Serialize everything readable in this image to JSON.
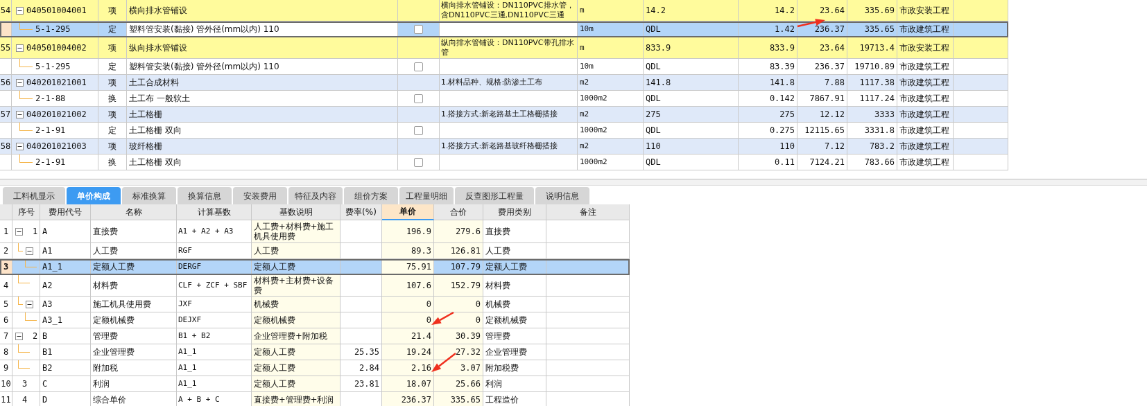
{
  "items": [
    {
      "line": "54",
      "code": "040501004001",
      "type": "项",
      "name": "横向排水管铺设",
      "desc": "横向排水管铺设：DN110PVC排水管，含DN110PVC三通,DN110PVC三通",
      "unit": "m",
      "qty_expr": "14.2",
      "qty": "14.2",
      "price": "23.64",
      "total": "335.69",
      "category": "市政安装工程",
      "color": "#fffb9c",
      "expanded": true,
      "selected": false,
      "children": [
        {
          "code": "5-1-295",
          "type": "定",
          "name": "塑料管安装(黏接) 管外径(mm以内) 110",
          "checked": false,
          "unit": "10m",
          "qty_expr": "QDL",
          "qty": "1.42",
          "price": "236.37",
          "total": "335.65",
          "category": "市政建筑工程",
          "selected": true
        }
      ]
    },
    {
      "line": "55",
      "code": "040501004002",
      "type": "项",
      "name": "纵向排水管铺设",
      "desc": "纵向排水管铺设：DN110PVC带孔排水管",
      "unit": "m",
      "qty_expr": "833.9",
      "qty": "833.9",
      "price": "23.64",
      "total": "19713.4",
      "category": "市政安装工程",
      "color": "#fffb9c",
      "expanded": true,
      "selected": false,
      "children": [
        {
          "code": "5-1-295",
          "type": "定",
          "name": "塑料管安装(黏接) 管外径(mm以内) 110",
          "checked": false,
          "unit": "10m",
          "qty_expr": "QDL",
          "qty": "83.39",
          "price": "236.37",
          "total": "19710.89",
          "category": "市政建筑工程",
          "selected": false
        }
      ]
    },
    {
      "line": "56",
      "code": "040201021001",
      "type": "项",
      "name": "土工合成材料",
      "desc": "1.材料品种、规格:防渗土工布",
      "unit": "m2",
      "qty_expr": "141.8",
      "qty": "141.8",
      "price": "7.88",
      "total": "1117.38",
      "category": "市政建筑工程",
      "color": "#dfe9f9",
      "expanded": true,
      "selected": false,
      "children": [
        {
          "code": "2-1-88",
          "type": "换",
          "name": "土工布 一般软土",
          "checked": false,
          "unit": "1000m2",
          "qty_expr": "QDL",
          "qty": "0.142",
          "price": "7867.91",
          "total": "1117.24",
          "category": "市政建筑工程",
          "selected": false
        }
      ]
    },
    {
      "line": "57",
      "code": "040201021002",
      "type": "项",
      "name": "土工格栅",
      "desc": "1.搭接方式:新老路基土工格栅搭接",
      "unit": "m2",
      "qty_expr": "275",
      "qty": "275",
      "price": "12.12",
      "total": "3333",
      "category": "市政建筑工程",
      "color": "#dfe9f9",
      "expanded": true,
      "selected": false,
      "children": [
        {
          "code": "2-1-91",
          "type": "定",
          "name": "土工格栅 双向",
          "checked": false,
          "unit": "1000m2",
          "qty_expr": "QDL",
          "qty": "0.275",
          "price": "12115.65",
          "total": "3331.8",
          "category": "市政建筑工程",
          "selected": false
        }
      ]
    },
    {
      "line": "58",
      "code": "040201021003",
      "type": "项",
      "name": "玻纤格栅",
      "desc": "1.搭接方式:新老路基玻纤格栅搭接",
      "unit": "m2",
      "qty_expr": "110",
      "qty": "110",
      "price": "7.12",
      "total": "783.2",
      "category": "市政建筑工程",
      "color": "#dfe9f9",
      "expanded": true,
      "selected": false,
      "children": [
        {
          "code": "2-1-91",
          "type": "换",
          "name": "土工格栅 双向",
          "checked": false,
          "unit": "1000m2",
          "qty_expr": "QDL",
          "qty": "0.11",
          "price": "7124.21",
          "total": "783.66",
          "category": "市政建筑工程",
          "selected": false
        }
      ]
    }
  ],
  "tabs": [
    {
      "label": "工料机显示",
      "selected": false
    },
    {
      "label": "单价构成",
      "selected": true
    },
    {
      "label": "标准换算",
      "selected": false
    },
    {
      "label": "换算信息",
      "selected": false
    },
    {
      "label": "安装费用",
      "selected": false
    },
    {
      "label": "特征及内容",
      "selected": false
    },
    {
      "label": "组价方案",
      "selected": false
    },
    {
      "label": "工程量明细",
      "selected": false
    },
    {
      "label": "反查图形工程量",
      "selected": false
    },
    {
      "label": "说明信息",
      "selected": false
    }
  ],
  "columns": [
    {
      "label": "序号",
      "selected": false
    },
    {
      "label": "费用代号",
      "selected": false
    },
    {
      "label": "名称",
      "selected": false
    },
    {
      "label": "计算基数",
      "selected": false
    },
    {
      "label": "基数说明",
      "selected": false
    },
    {
      "label": "费率(%)",
      "selected": false
    },
    {
      "label": "单价",
      "selected": true
    },
    {
      "label": "合价",
      "selected": false
    },
    {
      "label": "费用类别",
      "selected": false
    },
    {
      "label": "备注",
      "selected": false
    }
  ],
  "fees": [
    {
      "line": "1",
      "seq": "1",
      "code": "A",
      "name": "直接费",
      "base": "A1 + A2 + A3",
      "base_desc": "人工费+材料费+施工机具使用费",
      "unit_price": "196.9",
      "total": "279.6",
      "category": "直接费",
      "expanded": true,
      "selected": false,
      "children": [
        {
          "line": "2",
          "code": "A1",
          "name": "人工费",
          "base": "RGF",
          "base_desc": "人工费",
          "unit_price": "89.3",
          "total": "126.81",
          "category": "人工费",
          "expanded": true,
          "selected": false,
          "children": [
            {
              "line": "3",
              "code": "A1_1",
              "name": "定额人工费",
              "base": "DERGF",
              "base_desc": "定额人工费",
              "unit_price": "75.91",
              "total": "107.79",
              "category": "定额人工费",
              "selected": true
            }
          ]
        },
        {
          "line": "4",
          "code": "A2",
          "name": "材料费",
          "base": "CLF + ZCF + SBF",
          "base_desc": "材料费+主材费+设备费",
          "unit_price": "107.6",
          "total": "152.79",
          "category": "材料费",
          "selected": false
        },
        {
          "line": "5",
          "code": "A3",
          "name": "施工机具使用费",
          "base": "JXF",
          "base_desc": "机械费",
          "unit_price": "0",
          "total": "0",
          "category": "机械费",
          "expanded": true,
          "selected": false,
          "children": [
            {
              "line": "6",
              "code": "A3_1",
              "name": "定额机械费",
              "base": "DEJXF",
              "base_desc": "定额机械费",
              "unit_price": "0",
              "total": "0",
              "category": "定额机械费",
              "selected": false
            }
          ]
        }
      ]
    },
    {
      "line": "7",
      "seq": "2",
      "code": "B",
      "name": "管理费",
      "base": "B1 + B2",
      "base_desc": "企业管理费+附加税",
      "unit_price": "21.4",
      "total": "30.39",
      "category": "管理费",
      "expanded": true,
      "selected": false,
      "children": [
        {
          "line": "8",
          "code": "B1",
          "name": "企业管理费",
          "base": "A1_1",
          "base_desc": "定额人工费",
          "rate": "25.35",
          "unit_price": "19.24",
          "total": "27.32",
          "category": "企业管理费",
          "selected": false
        },
        {
          "line": "9",
          "code": "B2",
          "name": "附加税",
          "base": "A1_1",
          "base_desc": "定额人工费",
          "rate": "2.84",
          "unit_price": "2.16",
          "total": "3.07",
          "category": "附加税费",
          "selected": false
        }
      ]
    },
    {
      "line": "10",
      "seq": "3",
      "code": "C",
      "name": "利润",
      "base": "A1_1",
      "base_desc": "定额人工费",
      "rate": "23.81",
      "unit_price": "18.07",
      "total": "25.66",
      "category": "利润",
      "selected": false
    },
    {
      "line": "11",
      "seq": "4",
      "code": "D",
      "name": "综合单价",
      "base": "A + B + C",
      "base_desc": "直接费+管理费+利润",
      "unit_price": "236.37",
      "total": "335.65",
      "category": "工程造价",
      "selected": false
    }
  ]
}
